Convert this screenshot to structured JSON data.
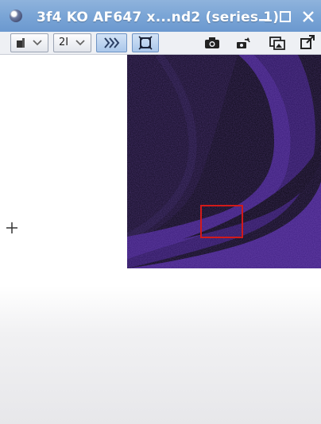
{
  "window": {
    "title": "3f4 KO AF647 x...nd2 (series 1)",
    "controls": [
      "minimize",
      "maximize",
      "close"
    ]
  },
  "toolbar": {
    "zoom_label": "2I",
    "dropdown_arrow": "chevron-down-icon",
    "buttons": [
      {
        "name": "display-mode-icon"
      },
      {
        "name": "channel-toggle-icon",
        "active": true
      },
      {
        "name": "fit-to-window-icon",
        "active": true
      },
      {
        "name": "camera-icon"
      },
      {
        "name": "rotate-snapshot-icon"
      },
      {
        "name": "image-overlay-icon"
      },
      {
        "name": "open-external-icon"
      }
    ]
  },
  "viewer": {
    "tissue_color": "#5a2fa8",
    "background_color": "#0a0715",
    "roi_color": "#d21a1a"
  }
}
